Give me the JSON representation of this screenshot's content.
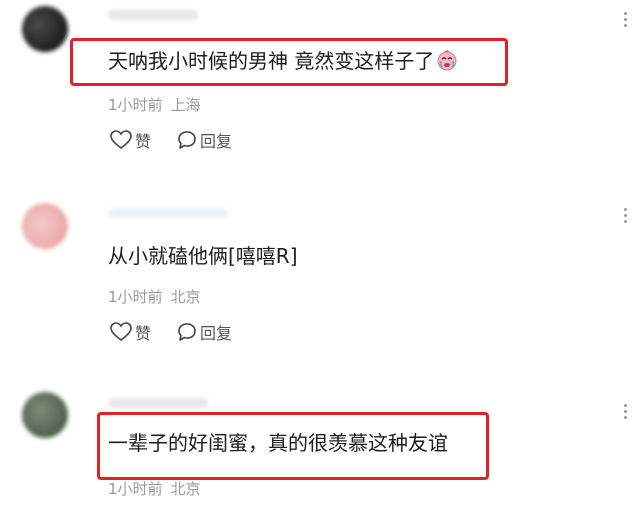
{
  "comments": [
    {
      "text": "天呐我小时候的男神 竟然变这样子了",
      "emoji": "crying-face-icon",
      "time": "1小时前",
      "location": "上海",
      "like_label": "赞",
      "reply_label": "回复",
      "highlighted": true
    },
    {
      "text": "从小就磕他俩[嘻嘻R]",
      "time": "1小时前",
      "location": "北京",
      "like_label": "赞",
      "reply_label": "回复",
      "highlighted": false
    },
    {
      "text": "一辈子的好闺蜜，真的很羡慕这种友谊",
      "time": "1小时前",
      "location": "北京",
      "highlighted": true
    }
  ],
  "colors": {
    "highlight": "#e41f26",
    "meta_text": "#9a9a9a",
    "body_text": "#1d1d1d"
  }
}
